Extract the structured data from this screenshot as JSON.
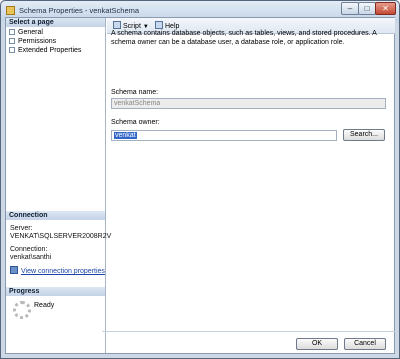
{
  "window": {
    "title": "Schema Properties - venkatSchema",
    "min": "–",
    "max": "□",
    "close": "✕"
  },
  "left_panel": {
    "select_page_header": "Select a page",
    "pages": [
      {
        "label": "General",
        "icon": "page-icon"
      },
      {
        "label": "Permissions",
        "icon": "page-icon"
      },
      {
        "label": "Extended Properties",
        "icon": "page-icon"
      }
    ],
    "connection_header": "Connection",
    "server_label": "Server:",
    "server_value": "VENKAT\\SQLSERVER2008R2V",
    "connection_label": "Connection:",
    "connection_value": "venkat\\santhi",
    "view_connection_link": "View connection properties",
    "progress_header": "Progress",
    "progress_status": "Ready"
  },
  "toolbar": {
    "script_label": "Script",
    "help_label": "Help"
  },
  "main": {
    "description": "A schema contains database objects, such as tables, views, and stored procedures. A schema owner can be a database user, a database role, or application role.",
    "schema_name_label": "Schema name:",
    "schema_name_value": "venkatSchema",
    "schema_owner_label": "Schema owner:",
    "schema_owner_value": "venkat",
    "search_button": "Search..."
  },
  "footer": {
    "ok_label": "OK",
    "cancel_label": "Cancel"
  }
}
